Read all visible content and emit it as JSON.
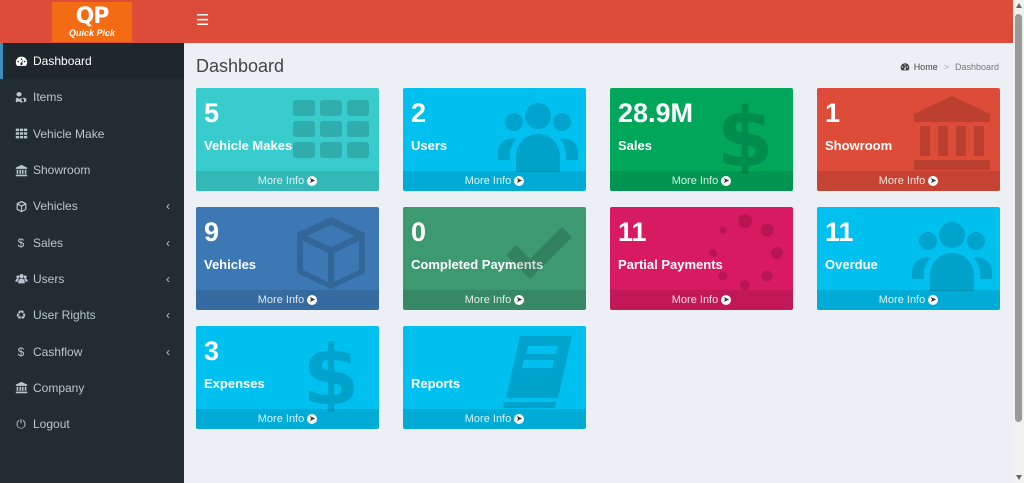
{
  "brand": {
    "mark": "QP",
    "name": "Quick Pick"
  },
  "sidebar": {
    "items": [
      {
        "label": "Dashboard",
        "icon": "dashboard-icon"
      },
      {
        "label": "Items",
        "icon": "cubes-icon"
      },
      {
        "label": "Vehicle Make",
        "icon": "grid-icon"
      },
      {
        "label": "Showroom",
        "icon": "bank-icon"
      },
      {
        "label": "Vehicles",
        "icon": "cube-icon"
      },
      {
        "label": "Sales",
        "icon": "dollar-icon"
      },
      {
        "label": "Users",
        "icon": "users-icon"
      },
      {
        "label": "User Rights",
        "icon": "recycle-icon"
      },
      {
        "label": "Cashflow",
        "icon": "dollar-icon"
      },
      {
        "label": "Company",
        "icon": "bank-icon"
      },
      {
        "label": "Logout",
        "icon": "power-icon"
      }
    ]
  },
  "header": {
    "title": "Dashboard"
  },
  "breadcrumb": {
    "home": "Home",
    "current": "Dashboard"
  },
  "more_info": "More Info",
  "boxes": [
    {
      "value": "5",
      "label": "Vehicle Makes",
      "color": "#39cccc"
    },
    {
      "value": "2",
      "label": "Users",
      "color": "#00c0ef"
    },
    {
      "value": "28.9M",
      "label": "Sales",
      "color": "#00a65a"
    },
    {
      "value": "1",
      "label": "Showroom",
      "color": "#dd4b39"
    },
    {
      "value": "9",
      "label": "Vehicles",
      "color": "#3c78b4"
    },
    {
      "value": "0",
      "label": "Completed Payments",
      "color": "#3d9970"
    },
    {
      "value": "11",
      "label": "Partial Payments",
      "color": "#d81b60"
    },
    {
      "value": "11",
      "label": "Overdue",
      "color": "#00c0ef"
    },
    {
      "value": "3",
      "label": "Expenses",
      "color": "#00c0ef"
    },
    {
      "value": "",
      "label": "Reports",
      "color": "#00c0ef"
    }
  ]
}
